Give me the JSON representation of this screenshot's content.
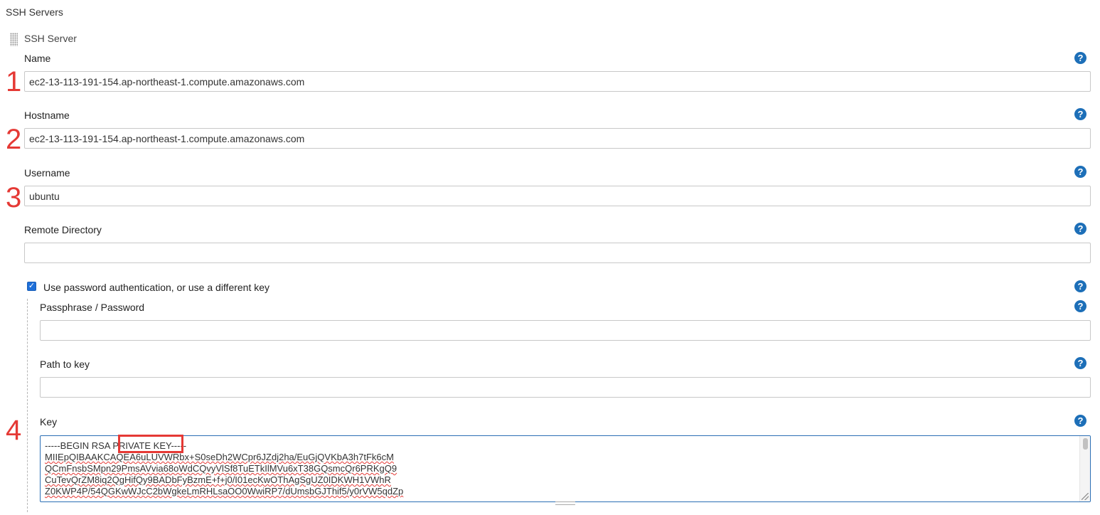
{
  "section_title": "SSH Servers",
  "server_title": "SSH Server",
  "help_glyph": "?",
  "fields": {
    "name": {
      "label": "Name",
      "value": "ec2-13-113-191-154.ap-northeast-1.compute.amazonaws.com",
      "step": "1"
    },
    "hostname": {
      "label": "Hostname",
      "value": "ec2-13-113-191-154.ap-northeast-1.compute.amazonaws.com",
      "step": "2"
    },
    "username": {
      "label": "Username",
      "value": "ubuntu",
      "step": "3"
    },
    "remote_directory": {
      "label": "Remote Directory",
      "value": ""
    }
  },
  "auth": {
    "checkbox_label": "Use password authentication, or use a different key",
    "checked": true,
    "passphrase": {
      "label": "Passphrase / Password",
      "value": ""
    },
    "path_to_key": {
      "label": "Path to key",
      "value": ""
    },
    "key": {
      "label": "Key",
      "step": "4",
      "lines": [
        "-----BEGIN RSA PRIVATE KEY-----",
        "MIIEpQIBAAKCAQEA6uLUVWRbx+S0seDh2WCpr6JZdj2ha/EuGjQVKbA3h7tFk6cM",
        "QCmFnsbSMpn29PmsAVvia68oWdCQvyVlSf8TuETkIlMVu6xT38GQsmcQr6PRKgQ9",
        "CuTevQrZM8iq2QgHifQy9BADbFyBzmE+f+j0/I01ecKwOThAgSgUZ0IDKWH1VWhR",
        "Z0KWP4P/54QGKwWJcC2bWgkeLmRHLsaOO0WwiRP7/dUmsbGJThif5/y0rVW5qdZp"
      ]
    }
  },
  "colors": {
    "annotation_red": "#e53935",
    "help_blue": "#1d6fb8",
    "checkbox_blue": "#1e6fd9"
  },
  "icons": {
    "help": "help-circle-icon",
    "drag": "drag-handle-icon",
    "check": "checkmark-icon"
  }
}
